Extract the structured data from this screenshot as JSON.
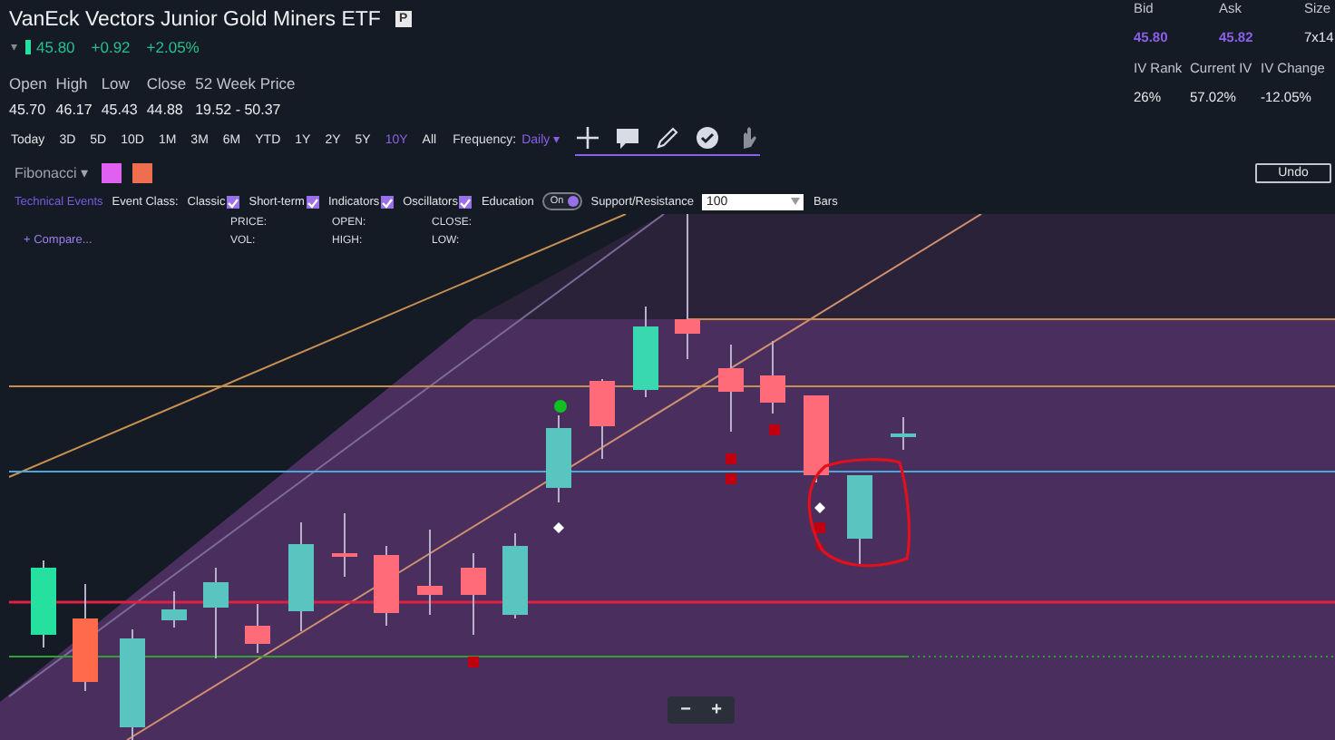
{
  "quote": {
    "title": "VanEck Vectors Junior Gold Miners ETF",
    "badge": "P",
    "caret": "▾",
    "last": "45.80",
    "change": "+0.92",
    "change_pct": "+2.05%",
    "stats": [
      {
        "label": "Open",
        "value": "45.70"
      },
      {
        "label": "High",
        "value": "46.17"
      },
      {
        "label": "Low",
        "value": "45.43"
      },
      {
        "label": "Close",
        "value": "44.88"
      },
      {
        "label": "52 Week Price",
        "value": "19.52 - 50.37"
      }
    ]
  },
  "market": {
    "quotes": [
      {
        "label": "Bid",
        "value": "45.80",
        "highlight": true
      },
      {
        "label": "Ask",
        "value": "45.82",
        "highlight": true
      },
      {
        "label": "Size",
        "value": "7x14",
        "highlight": false
      }
    ],
    "volatility": [
      {
        "label": "IV Rank",
        "value": "26%"
      },
      {
        "label": "Current IV",
        "value": "57.02%"
      },
      {
        "label": "IV Change",
        "value": "-12.05%"
      }
    ]
  },
  "toolbar": {
    "ranges": [
      {
        "label": "Today",
        "selected": false
      },
      {
        "label": "3D",
        "selected": false
      },
      {
        "label": "5D",
        "selected": false
      },
      {
        "label": "10D",
        "selected": false
      },
      {
        "label": "1M",
        "selected": false
      },
      {
        "label": "3M",
        "selected": false
      },
      {
        "label": "6M",
        "selected": false
      },
      {
        "label": "YTD",
        "selected": false
      },
      {
        "label": "1Y",
        "selected": false
      },
      {
        "label": "2Y",
        "selected": false
      },
      {
        "label": "5Y",
        "selected": false
      },
      {
        "label": "10Y",
        "selected": true
      },
      {
        "label": "All",
        "selected": false
      }
    ],
    "frequency_label": "Frequency:",
    "frequency": "Daily",
    "caret": "▾",
    "tools": [
      {
        "kind": "crosshair",
        "selected": true
      },
      {
        "kind": "comment",
        "selected": true
      },
      {
        "kind": "pencil",
        "selected": true
      },
      {
        "kind": "check",
        "selected": true
      },
      {
        "kind": "hand",
        "selected": false
      }
    ]
  },
  "drawing": {
    "tool": "Fibonacci",
    "caret": "▾",
    "swatches": [
      {
        "color": "#e060f0"
      },
      {
        "color": "#f06e50"
      }
    ],
    "undo": "Undo"
  },
  "events": {
    "link": "Technical Events",
    "class_label": "Event Class:",
    "classes": [
      {
        "label": "Classic",
        "checked": true
      },
      {
        "label": "Short-term",
        "checked": true
      },
      {
        "label": "Indicators",
        "checked": true
      },
      {
        "label": "Oscillators",
        "checked": true
      }
    ],
    "education_label": "Education",
    "education_toggle": {
      "label": "On",
      "on": true
    },
    "sr_label": "Support/Resistance",
    "sr_value": "100",
    "sr_unit": "Bars"
  },
  "chart": {
    "compare": "+ Compare...",
    "legend": [
      {
        "label": "PRICE:"
      },
      {
        "label": "VOL:"
      },
      {
        "label": "OPEN:"
      },
      {
        "label": "HIGH:"
      },
      {
        "label": "CLOSE:"
      },
      {
        "label": "LOW:"
      }
    ],
    "zoom_buttons": [
      "−",
      "+"
    ]
  }
}
